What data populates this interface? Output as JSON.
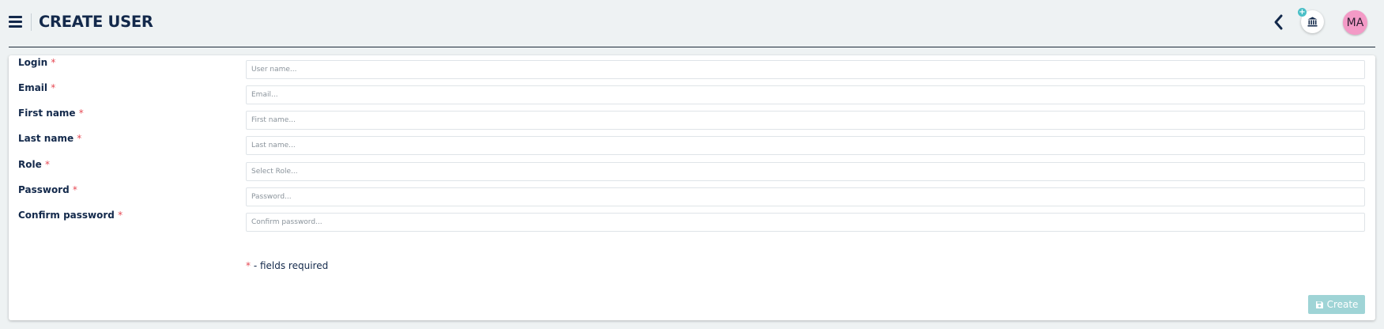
{
  "header": {
    "title": "CREATE USER",
    "menu_icon": "hamburger-menu-icon",
    "back_icon": "chevron-left-icon",
    "bank_icon": "bank-icon",
    "bank_badge": "+",
    "avatar_initials": "MA"
  },
  "form": {
    "fields": [
      {
        "label": "Login",
        "placeholder": "User name..."
      },
      {
        "label": "Email",
        "placeholder": "Email..."
      },
      {
        "label": "First name",
        "placeholder": "First name..."
      },
      {
        "label": "Last name",
        "placeholder": "Last name..."
      },
      {
        "label": "Role",
        "placeholder": "Select Role..."
      },
      {
        "label": "Password",
        "placeholder": "Password..."
      },
      {
        "label": "Confirm password",
        "placeholder": "Confirm password..."
      }
    ],
    "required_marker": "*",
    "required_note": "- fields required",
    "create_label": "Create",
    "create_icon": "floppy-disk-icon"
  },
  "colors": {
    "accent": "#9fd4d6",
    "required": "#e64a55",
    "text": "#13294b",
    "avatar": "#f39ac6",
    "background": "#eef2f3"
  }
}
